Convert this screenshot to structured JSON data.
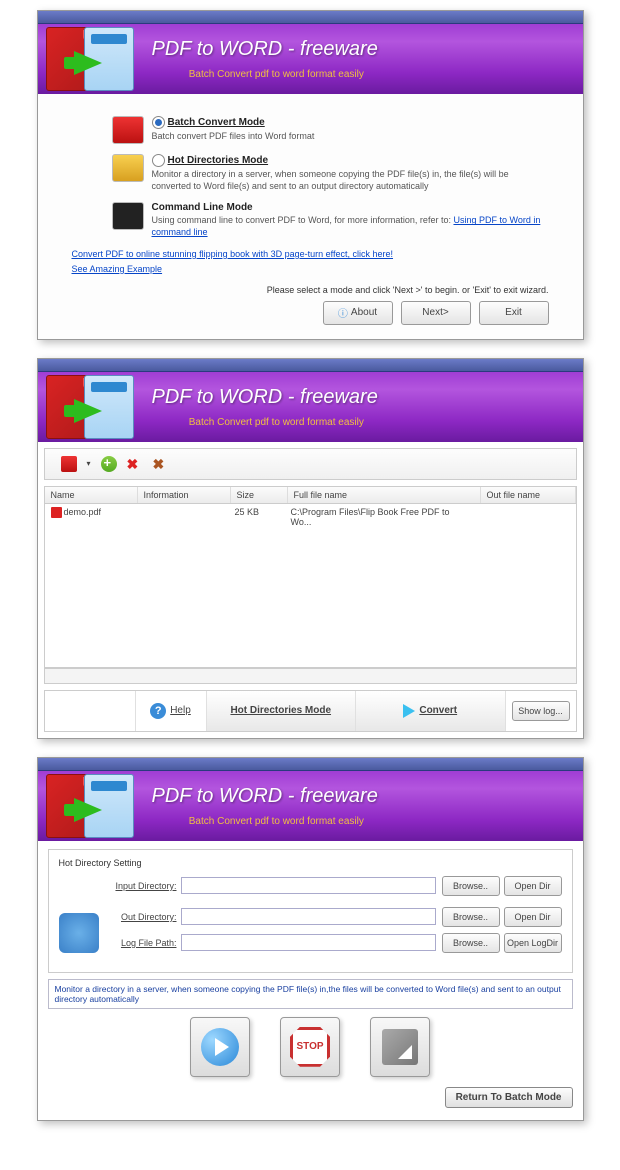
{
  "header": {
    "title": "PDF to WORD - freeware",
    "subtitle": "Batch Convert pdf to word format easily"
  },
  "modes": {
    "batch": {
      "title": "Batch Convert Mode",
      "desc": "Batch convert PDF files into Word format"
    },
    "hot": {
      "title": "Hot Directories Mode",
      "desc": "Monitor a directory in a server, when someone copying the PDF file(s) in, the file(s) will be converted to Word file(s) and sent to an output directory automatically"
    },
    "cmd": {
      "title": "Command Line Mode",
      "desc": "Using command line to convert PDF to Word, for more information, refer to:",
      "link": "Using PDF to Word in command line"
    }
  },
  "links": {
    "flip": "Convert PDF to online stunning flipping book with 3D page-turn effect, click here!",
    "example": "See Amazing Example "
  },
  "hint": "Please select a mode and click 'Next >' to begin. or 'Exit' to exit wizard.",
  "buttons": {
    "about": "About",
    "next": "Next>",
    "exit": "Exit",
    "help": "Help",
    "hot": "Hot Directories Mode",
    "convert": "Convert",
    "showlog": "Show log...",
    "browse": "Browse..",
    "opendir": "Open Dir",
    "openlog": "Open LogDir",
    "return": "Return To Batch Mode",
    "stop": "STOP"
  },
  "table": {
    "headers": {
      "name": "Name",
      "info": "Information",
      "size": "Size",
      "full": "Full file name",
      "out": "Out file name"
    },
    "row": {
      "name": "demo.pdf",
      "size": "25 KB",
      "full": "C:\\Program Files\\Flip Book Free PDF to Wo..."
    }
  },
  "hd": {
    "legend": "Hot Directory Setting",
    "input": "Input Directory:",
    "out": "Out Directory:",
    "log": "Log File Path:",
    "note": "Monitor a directory in a server, when someone copying the PDF file(s) in,the files will be converted to Word file(s) and sent to an output directory automatically"
  }
}
